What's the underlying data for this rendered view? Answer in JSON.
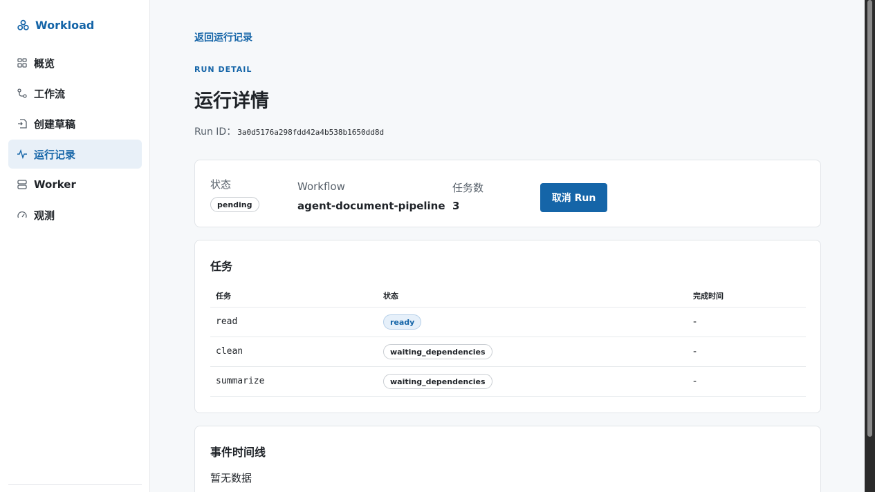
{
  "brand": {
    "name": "Workload",
    "icon": "cluster-icon",
    "color": "#1565a8"
  },
  "sidebar": {
    "items": [
      {
        "label": "概览",
        "icon": "grid-icon",
        "active": false
      },
      {
        "label": "工作流",
        "icon": "workflow-icon",
        "active": false
      },
      {
        "label": "创建草稿",
        "icon": "draft-icon",
        "active": false
      },
      {
        "label": "运行记录",
        "icon": "activity-icon",
        "active": true
      },
      {
        "label": "Worker",
        "icon": "server-icon",
        "active": false
      },
      {
        "label": "观测",
        "icon": "gauge-icon",
        "active": false
      }
    ]
  },
  "page": {
    "back_link": "返回运行记录",
    "eyebrow": "RUN DETAIL",
    "title": "运行详情",
    "run_id_label": "Run ID：",
    "run_id": "3a0d5176a298fdd42a4b538b1650dd8d"
  },
  "summary": {
    "status_label": "状态",
    "status_value": "pending",
    "workflow_label": "Workflow",
    "workflow_value": "agent-document-pipeline",
    "task_count_label": "任务数",
    "task_count_value": "3",
    "cancel_label": "取消 Run"
  },
  "tasks": {
    "title": "任务",
    "columns": [
      "任务",
      "状态",
      "完成时间"
    ],
    "rows": [
      {
        "name": "read",
        "status": "ready",
        "completed": "-"
      },
      {
        "name": "clean",
        "status": "waiting_dependencies",
        "completed": "-"
      },
      {
        "name": "summarize",
        "status": "waiting_dependencies",
        "completed": "-"
      }
    ]
  },
  "events": {
    "title": "事件时间线",
    "empty": "暂无数据"
  },
  "colors": {
    "accent": "#1565a8",
    "background": "#f6f8fa",
    "active_nav_bg": "#e8f0f8"
  }
}
